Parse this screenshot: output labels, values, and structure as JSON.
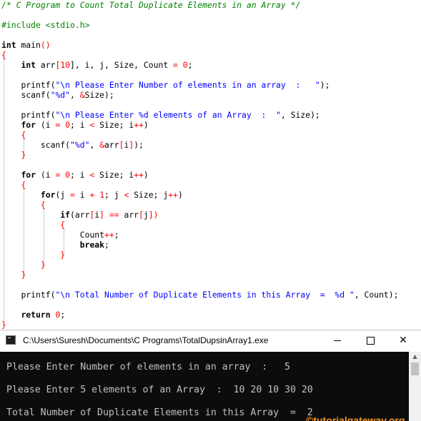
{
  "code": {
    "line01": {
      "comment": "/* C Program to Count Total Duplicate Elements in an Array */"
    },
    "line03": {
      "directive": "#include <stdio.h>"
    },
    "line05": {
      "type": "int",
      "name": " main",
      "parens": "()"
    },
    "line06": {
      "brace": "{"
    },
    "line07": {
      "t1": "int",
      "t2": " arr",
      "t3": "[",
      "t4": "10",
      "t5": "], i, j, Size, Count ",
      "t6": "=",
      "t7": " ",
      "t8": "0",
      "t9": ";"
    },
    "line09": {
      "t1": "printf(",
      "t2": "\"\\n Please Enter Number of elements in an array  :   \"",
      "t3": ");"
    },
    "line10": {
      "t1": "scanf(",
      "t2": "\"%d\"",
      "t3": ", ",
      "t4": "&",
      "t5": "Size);"
    },
    "line12": {
      "t1": "printf(",
      "t2": "\"\\n Please Enter %d elements of an Array  :  \"",
      "t3": ", Size);"
    },
    "line13": {
      "t1": "for",
      "t2": " (i ",
      "t3": "=",
      "t4": " ",
      "t5": "0",
      "t6": "; i ",
      "t7": "<",
      "t8": " Size; i",
      "t9": "++",
      "t10": ")"
    },
    "line14": {
      "brace": "{"
    },
    "line15": {
      "t1": "scanf(",
      "t2": "\"%d\"",
      "t3": ", ",
      "t4": "&",
      "t5": "arr",
      "t6": "[",
      "t7": "i",
      "t8": "]",
      "t9": ");"
    },
    "line16": {
      "brace": "}"
    },
    "line18": {
      "t1": "for",
      "t2": " (i ",
      "t3": "=",
      "t4": " ",
      "t5": "0",
      "t6": "; i ",
      "t7": "<",
      "t8": " Size; i",
      "t9": "++",
      "t10": ")"
    },
    "line19": {
      "brace": "{"
    },
    "line20": {
      "t1": "for",
      "t2": "(j ",
      "t3": "=",
      "t4": " i ",
      "t5": "+",
      "t6": " ",
      "t7": "1",
      "t8": "; j ",
      "t9": "<",
      "t10": " Size; j",
      "t11": "++",
      "t12": ")"
    },
    "line21": {
      "brace": "{"
    },
    "line22": {
      "t1": "if",
      "t2": "(arr",
      "t3": "[",
      "t4": "i",
      "t5": "]",
      "t6": " ",
      "t7": "==",
      "t8": " arr",
      "t9": "[",
      "t10": "j",
      "t11": "])"
    },
    "line23": {
      "brace": "{"
    },
    "line24": {
      "t1": "Count",
      "t2": "++",
      "t3": ";"
    },
    "line25": {
      "t1": "break",
      "t2": ";"
    },
    "line26": {
      "brace": "}"
    },
    "line27": {
      "brace": "}"
    },
    "line28": {
      "brace": "}"
    },
    "line30": {
      "t1": "printf(",
      "t2": "\"\\n Total Number of Duplicate Elements in this Array  =  %d \"",
      "t3": ", Count);"
    },
    "line32": {
      "t1": "return",
      "t2": " ",
      "t3": "0",
      "t4": ";"
    },
    "line33": {
      "brace": "}"
    }
  },
  "console": {
    "title": "C:\\Users\\Suresh\\Documents\\C Programs\\TotalDupsinArray1.exe",
    "output": [
      "Please Enter Number of elements in an array  :   5",
      "Please Enter 5 elements of an Array  :  10 20 10 30 20",
      "Total Number of Duplicate Elements in this Array  =  2"
    ],
    "watermark": "©tutorialgateway.org"
  },
  "colors": {
    "comment": "#008000",
    "string": "#0000ff",
    "operator": "#ff0000",
    "terminal_bg": "#0c0c0c",
    "terminal_fg": "#c0c0c0",
    "watermark": "#f7941d"
  },
  "icons": {
    "app": "console-app-icon",
    "minimize": "minimize-icon",
    "maximize": "maximize-icon",
    "close": "close-icon",
    "scroll_up": "scroll-up-arrow-icon"
  }
}
